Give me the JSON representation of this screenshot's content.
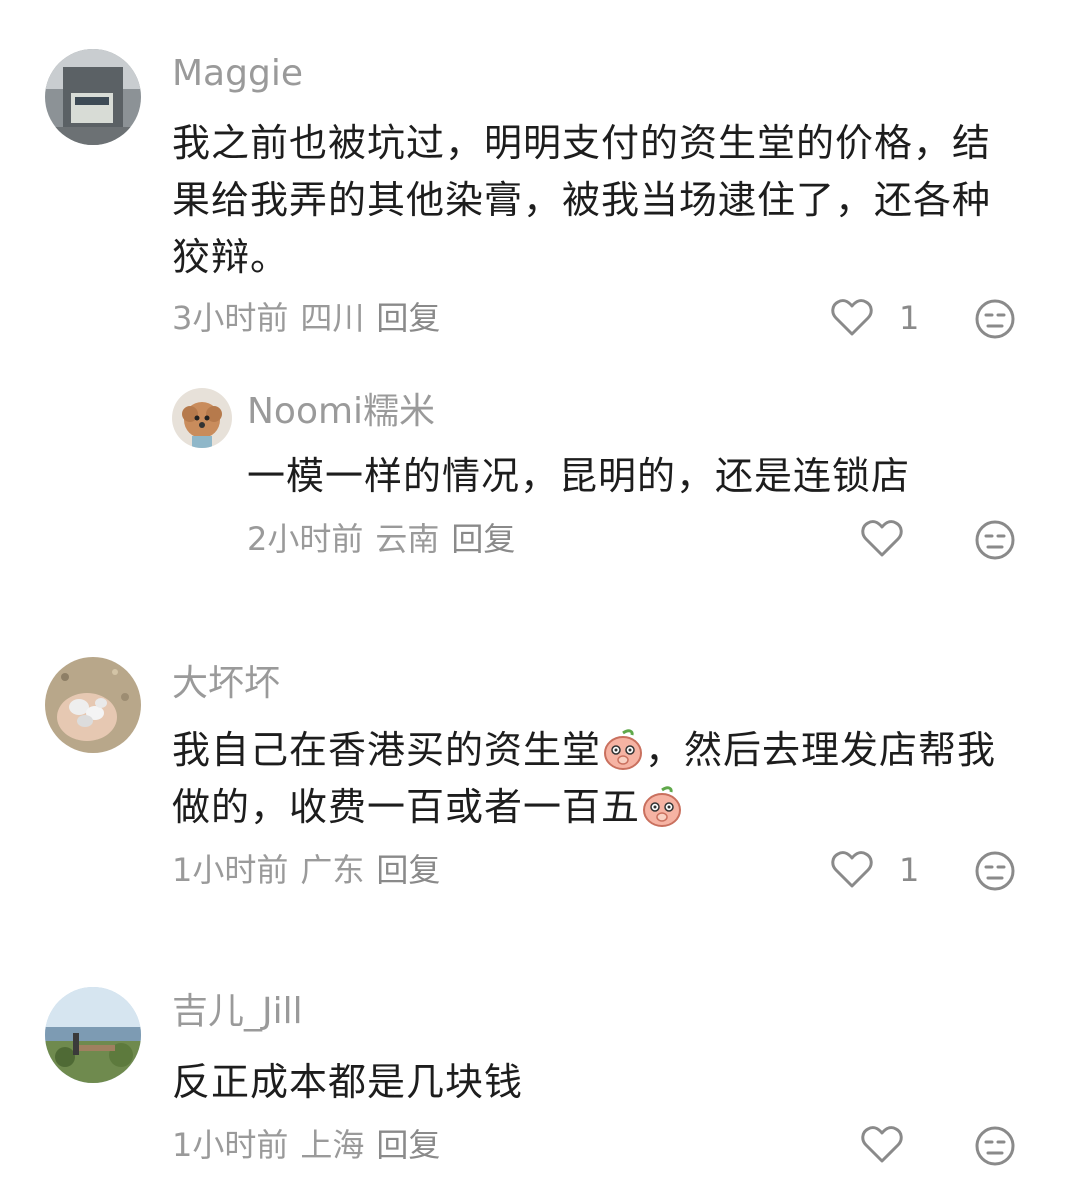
{
  "comments": [
    {
      "username": "Maggie",
      "text": "我之前也被坑过，明明支付的资生堂的价格，结果给我弄的其他染膏，被我当场逮住了，还各种狡辩。",
      "time": "3小时前",
      "location": "四川",
      "reply_label": "回复",
      "likes": "1"
    },
    {
      "username": "Noomi糯米",
      "text": "一模一样的情况，昆明的，还是连锁店",
      "time": "2小时前",
      "location": "云南",
      "reply_label": "回复",
      "likes": ""
    },
    {
      "username": "大坏坏",
      "text_part1": "我自己在香港买的资生堂",
      "text_part2": "，然后去理发店帮我做的，收费一百或者一百五",
      "time": "1小时前",
      "location": "广东",
      "reply_label": "回复",
      "likes": "1"
    },
    {
      "username": "吉儿_Jill",
      "text": "反正成本都是几块钱",
      "time": "1小时前",
      "location": "上海",
      "reply_label": "回复",
      "likes": ""
    }
  ],
  "icons": {
    "like": "heart-outline-icon",
    "dislike": "neutral-face-icon",
    "emoji": "peach-face-emoji"
  },
  "colors": {
    "username": "#9a9a9a",
    "text": "#1d1d1d",
    "meta": "#9a9a9a",
    "icon": "#8a8a8a"
  }
}
